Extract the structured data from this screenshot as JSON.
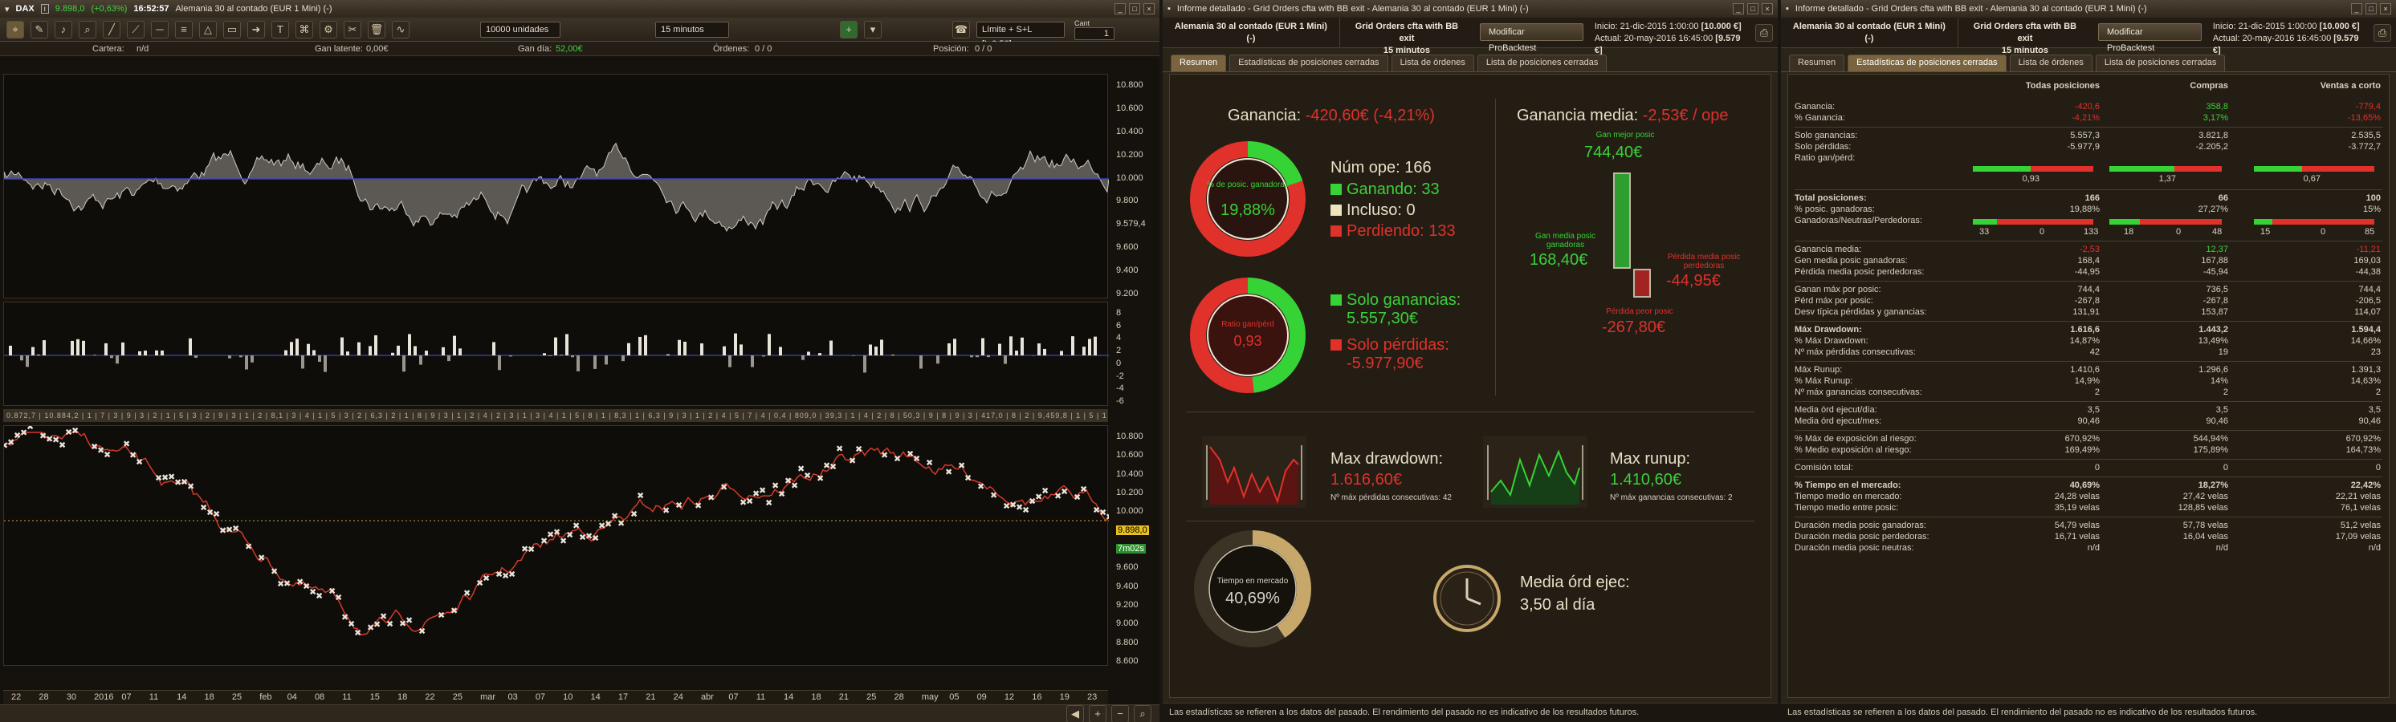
{
  "chart_window": {
    "title": {
      "ticker": "DAX",
      "price": "9.898,0",
      "change": "(+0,63%)",
      "time": "16:52:57",
      "instrument": "Alemania 30 al contado (EUR 1 Mini) (-)"
    },
    "toolbar": {
      "units": "10000 unidades",
      "timeframe": "15 minutos",
      "cant_label": "Cant",
      "order_type": "Límite + S+L [L,0,50]",
      "qty": "1"
    },
    "infobar": {
      "cartera_label": "Cartera:",
      "cartera_value": "n/d",
      "latente_label": "Gan latente:",
      "latente_value": "0,00€",
      "dia_label": "Gan día:",
      "dia_value": "52,00€",
      "ordenes_label": "Órdenes:",
      "ordenes_value": "0 / 0",
      "posicion_label": "Posición:",
      "posicion_value": "0 / 0"
    },
    "equity_axis": [
      "10.800",
      "10.600",
      "10.400",
      "10.200",
      "10.000",
      "9.800",
      "9.579,4",
      "9.600",
      "9.400",
      "9.200"
    ],
    "hist_axis": [
      "8",
      "6",
      "4",
      "2",
      "0",
      "-2",
      "-4",
      "-6"
    ],
    "price_axis": [
      "10.800",
      "10.600",
      "10.400",
      "10.200",
      "10.000",
      "9.898,0",
      "7m02s",
      "9.600",
      "9.400",
      "9.200",
      "9.000",
      "8.800",
      "8.600"
    ],
    "ticker_band": "0.872,7 | 10.884,2 | 1 | 7 | 3 | 9 | 3 | 2 | 1 | 5 | 3 | 2 | 9 | 3 | 1 | 2 | 8,1 | 3 | 4 | 1 | 5 | 3 | 2 | 6,3 | 2 | 1 | 8 | 9 | 3 | 1 | 2 | 4 | 2 | 3 | 1 | 3 | 4 | 1 | 5 | 8 | 1 | 8,3 | 1 | 6,3 | 9 | 3 | 1 | 2 | 4 | 5 | 7 | 4 | 0,4 | 809,0 | 39,3 | 1 | 4 | 2 | 8 | 50,3 | 9 | 8 | 9 | 3 | 417,0 | 8 | 2 | 9,459,8 | 1 | 5 | 1 | 5 | 1 | 9 | 1 | 0 | 3 | 8,1 | 2 | 7 | 1 | 3 | 1 | 3",
    "xaxis": [
      "22",
      "28",
      "30",
      "2016",
      "07",
      "11",
      "14",
      "18",
      "25",
      "feb",
      "04",
      "08",
      "11",
      "15",
      "18",
      "22",
      "25",
      "mar",
      "03",
      "07",
      "10",
      "14",
      "17",
      "21",
      "24",
      "abr",
      "07",
      "11",
      "14",
      "18",
      "21",
      "25",
      "28",
      "may",
      "05",
      "09",
      "12",
      "16",
      "19",
      "23"
    ]
  },
  "report1": {
    "title": "Informe detallado - Grid Orders cfta with BB exit - Alemania 30 al contado (EUR 1 Mini) (-)",
    "instrument": "Alemania 30 al contado (EUR 1 Mini) (-)",
    "strategy": "Grid Orders cfta with BB exit",
    "timeframe": "15 minutos",
    "modify_button": "Modificar ProBacktest",
    "inicio_label": "Inicio:",
    "inicio": "21-dic-2015 1:00:00",
    "inicio_val": "[10.000 €]",
    "actual_label": "Actual:",
    "actual": "20-may-2016 16:45:00",
    "actual_val": "[9.579 €]",
    "tabs": [
      "Resumen",
      "Estadísticas de posiciones cerradas",
      "Lista de órdenes",
      "Lista de posiciones cerradas"
    ],
    "ganancia_label": "Ganancia:",
    "ganancia": "-420,60€ (-4,21%)",
    "gan_media_label": "Ganancia media:",
    "gan_media": "-2,53€ / ope",
    "donut1_text": "% de posic. ganadoras",
    "donut1_value": "19,88%",
    "num_ope_label": "Núm ope:",
    "num_ope": "166",
    "ganando_label": "Ganando:",
    "ganando": "33",
    "incluso_label": "Incluso:",
    "incluso": "0",
    "perdiendo_label": "Perdiendo:",
    "perdiendo": "133",
    "donut2_text": "Ratio gan/pérd",
    "donut2_value": "0,93",
    "solo_gan_label": "Solo ganancias:",
    "solo_gan": "5.557,30€",
    "solo_perd_label": "Solo pérdidas:",
    "solo_perd": "-5.977,90€",
    "gan_mejor_label": "Gan mejor posic",
    "gan_mejor": "744,40€",
    "gan_media_pos_label": "Gan media posic ganadoras",
    "gan_media_pos": "168,40€",
    "perd_media_label": "Pérdida media posic perdedoras",
    "perd_media": "-44,95€",
    "perd_peor_label": "Pérdida peor posic",
    "perd_peor": "-267,80€",
    "max_dd_label": "Max drawdown:",
    "max_dd": "1.616,60€",
    "max_dd_sub": "Nº máx pérdidas consecutivas: 42",
    "max_ru_label": "Max runup:",
    "max_ru": "1.410,60€",
    "max_ru_sub": "Nº máx ganancias consecutivas: 2",
    "tiempo_label": "Tiempo en mercado",
    "tiempo": "40,69%",
    "media_ord_label": "Media órd ejec:",
    "media_ord": "3,50 al día",
    "disclaimer": "Las estadísticas se refieren a los datos del pasado. El rendimiento del pasado no es indicativo de los resultados futuros."
  },
  "report2": {
    "title": "Informe detallado - Grid Orders cfta with BB exit - Alemania 30 al contado (EUR 1 Mini) (-)",
    "instrument": "Alemania 30 al contado (EUR 1 Mini) (-)",
    "strategy": "Grid Orders cfta with BB exit",
    "timeframe": "15 minutos",
    "modify_button": "Modificar ProBacktest",
    "inicio_label": "Inicio:",
    "inicio": "21-dic-2015 1:00:00",
    "inicio_val": "[10.000 €]",
    "actual_label": "Actual:",
    "actual": "20-may-2016 16:45:00",
    "actual_val": "[9.579 €]",
    "tabs": [
      "Resumen",
      "Estadísticas de posiciones cerradas",
      "Lista de órdenes",
      "Lista de posiciones cerradas"
    ],
    "columns": [
      "Todas posiciones",
      "Compras",
      "Ventas a corto"
    ],
    "rows": [
      {
        "label": "Ganancia:",
        "v": [
          "-420,6",
          "358,8",
          "-779,4"
        ],
        "c": "mix"
      },
      {
        "label": "% Ganancia:",
        "v": [
          "-4,21%",
          "3,17%",
          "-13,65%"
        ],
        "c": "mix"
      },
      {
        "sep": true
      },
      {
        "label": "Solo ganancias:",
        "v": [
          "5.557,3",
          "3.821,8",
          "2.535,5"
        ]
      },
      {
        "label": "Solo pérdidas:",
        "v": [
          "-5.977,9",
          "-2.205,2",
          "-3.772,7"
        ]
      },
      {
        "label": "Ratio gan/pérd:",
        "v": [
          "0,93",
          "1,37",
          "0,67"
        ],
        "bar": [
          0.48,
          0.58,
          0.4
        ]
      },
      {
        "sep": true
      },
      {
        "label": "Total posiciones:",
        "v": [
          "166",
          "66",
          "100"
        ],
        "bold": true
      },
      {
        "label": "% posic. ganadoras:",
        "v": [
          "19,88%",
          "27,27%",
          "15%"
        ]
      },
      {
        "label": "Ganadoras/Neutras/Perdedoras:",
        "tri": [
          [
            "33",
            "0",
            "133"
          ],
          [
            "18",
            "0",
            "48"
          ],
          [
            "15",
            "0",
            "85"
          ]
        ],
        "bar": [
          0.2,
          0.27,
          0.15
        ]
      },
      {
        "sep": true
      },
      {
        "label": "Ganancia media:",
        "v": [
          "-2,53",
          "12,37",
          "-11,21"
        ],
        "c": "mix"
      },
      {
        "label": "Gen media posic ganadoras:",
        "v": [
          "168,4",
          "167,88",
          "169,03"
        ]
      },
      {
        "label": "Pérdida media posic perdedoras:",
        "v": [
          "-44,95",
          "-45,94",
          "-44,38"
        ]
      },
      {
        "sep": true
      },
      {
        "label": "Ganan máx por posic:",
        "v": [
          "744,4",
          "736,5",
          "744,4"
        ]
      },
      {
        "label": "Pérd máx por posic:",
        "v": [
          "-267,8",
          "-267,8",
          "-206,5"
        ]
      },
      {
        "label": "Desv típica pérdidas y ganancias:",
        "v": [
          "131,91",
          "153,87",
          "114,07"
        ]
      },
      {
        "sep": true
      },
      {
        "label": "Máx Drawdown:",
        "v": [
          "1.616,6",
          "1.443,2",
          "1.594,4"
        ],
        "bold": true
      },
      {
        "label": "% Máx Drawdown:",
        "v": [
          "14,87%",
          "13,49%",
          "14,66%"
        ]
      },
      {
        "label": "Nº máx pérdidas consecutivas:",
        "v": [
          "42",
          "19",
          "23"
        ]
      },
      {
        "sep": true
      },
      {
        "label": "Máx Runup:",
        "v": [
          "1.410,6",
          "1.296,6",
          "1.391,3"
        ]
      },
      {
        "label": "% Máx Runup:",
        "v": [
          "14,9%",
          "14%",
          "14,63%"
        ]
      },
      {
        "label": "Nº máx ganancias consecutivas:",
        "v": [
          "2",
          "2",
          "2"
        ]
      },
      {
        "sep": true
      },
      {
        "label": "Media órd ejecut/día:",
        "v": [
          "3,5",
          "3,5",
          "3,5"
        ]
      },
      {
        "label": "Media órd ejecut/mes:",
        "v": [
          "90,46",
          "90,46",
          "90,46"
        ]
      },
      {
        "sep": true
      },
      {
        "label": "% Máx de exposición al riesgo:",
        "v": [
          "670,92%",
          "544,94%",
          "670,92%"
        ]
      },
      {
        "label": "% Medio exposición al riesgo:",
        "v": [
          "169,49%",
          "175,89%",
          "164,73%"
        ]
      },
      {
        "sep": true
      },
      {
        "label": "Comisión total:",
        "v": [
          "0",
          "0",
          "0"
        ]
      },
      {
        "sep": true
      },
      {
        "label": "% Tiempo en el mercado:",
        "v": [
          "40,69%",
          "18,27%",
          "22,42%"
        ],
        "bold": true
      },
      {
        "label": "Tiempo medio en mercado:",
        "v": [
          "24,28 velas",
          "27,42 velas",
          "22,21 velas"
        ]
      },
      {
        "label": "Tiempo medio entre posic:",
        "v": [
          "35,19 velas",
          "128,85 velas",
          "76,1 velas"
        ]
      },
      {
        "sep": true
      },
      {
        "label": "Duración media posic ganadoras:",
        "v": [
          "54,79 velas",
          "57,78 velas",
          "51,2 velas"
        ]
      },
      {
        "label": "Duración media posic perdedoras:",
        "v": [
          "16,71 velas",
          "16,04 velas",
          "17,09 velas"
        ]
      },
      {
        "label": "Duración media posic neutras:",
        "v": [
          "n/d",
          "n/d",
          "n/d"
        ]
      }
    ],
    "disclaimer": "Las estadísticas se refieren a los datos del pasado. El rendimiento del pasado no es indicativo de los resultados futuros."
  }
}
